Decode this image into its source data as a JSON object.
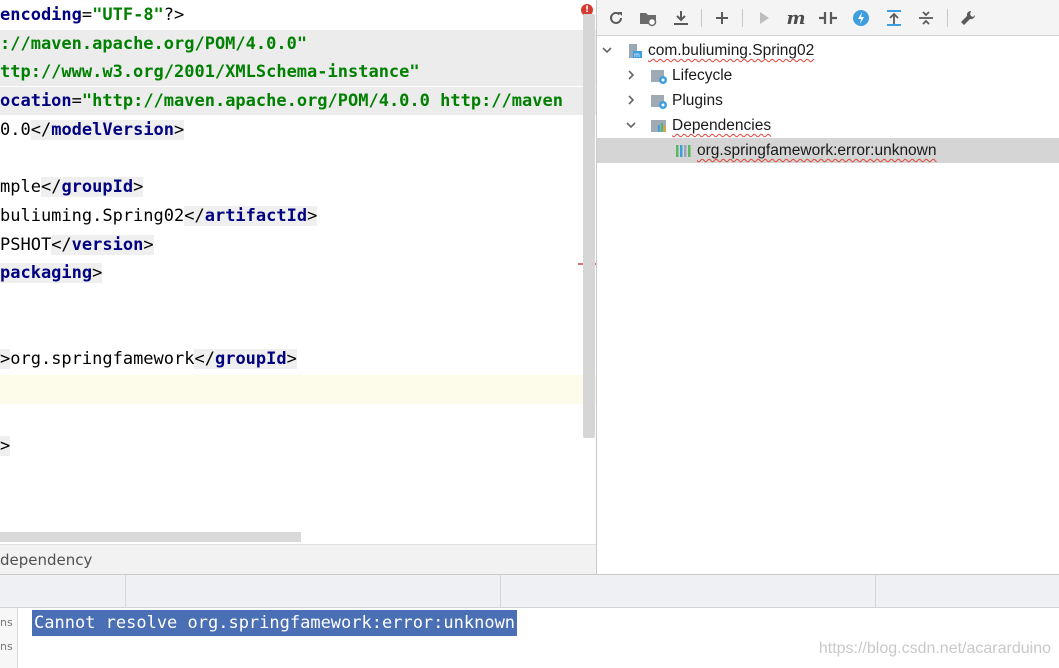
{
  "editor": {
    "lines": [
      {
        "parts": [
          [
            "tag",
            "encoding"
          ],
          [
            "pun",
            "="
          ],
          [
            "str",
            "\"UTF-8\""
          ],
          [
            "pun",
            "?>"
          ]
        ]
      },
      {
        "parts": [
          [
            "str",
            ":"
          ],
          [
            "str",
            "//maven.apache.org/POM/4.0.0\""
          ]
        ]
      },
      {
        "parts": [
          [
            "str",
            "ttp://www.w3.org/2001/XMLSchema-instance\""
          ]
        ]
      },
      {
        "parts": [
          [
            "tag",
            "ocation"
          ],
          [
            "pun",
            "="
          ],
          [
            "str",
            "\"http://maven.apache.org/POM/4.0.0 http://maven"
          ]
        ]
      },
      {
        "parts": [
          [
            "txt",
            "0.0"
          ],
          [
            "pun",
            "</"
          ],
          [
            "tag",
            "modelVersion"
          ],
          [
            "pun",
            ">"
          ]
        ]
      },
      {
        "parts": []
      },
      {
        "parts": [
          [
            "txt",
            "mple"
          ],
          [
            "pun",
            "</"
          ],
          [
            "tag",
            "groupId"
          ],
          [
            "pun",
            ">"
          ]
        ]
      },
      {
        "parts": [
          [
            "txt",
            "buliuming.Spring02"
          ],
          [
            "pun",
            "</"
          ],
          [
            "tag",
            "artifactId"
          ],
          [
            "pun",
            ">"
          ]
        ]
      },
      {
        "parts": [
          [
            "txt",
            "PSHOT"
          ],
          [
            "pun",
            "</"
          ],
          [
            "tag",
            "version"
          ],
          [
            "pun",
            ">"
          ]
        ]
      },
      {
        "parts": [
          [
            "tag",
            "packaging"
          ],
          [
            "pun",
            ">"
          ]
        ]
      },
      {
        "parts": []
      },
      {
        "parts": []
      },
      {
        "parts": [
          [
            "pun",
            ">"
          ],
          [
            "txt",
            "org.springfamework"
          ],
          [
            "pun",
            "</"
          ],
          [
            "tag",
            "groupId"
          ],
          [
            "pun",
            ">"
          ]
        ]
      },
      {
        "parts": []
      },
      {
        "parts": []
      },
      {
        "parts": [
          [
            "pun",
            ">"
          ]
        ]
      }
    ],
    "breadcrumb": "dependency",
    "error_marker": "!"
  },
  "maven": {
    "toolbar": [
      "reload-icon",
      "reimport-folder-icon",
      "download-icon",
      "add-icon",
      "run-icon",
      "execute-goal-icon",
      "toggle-offline-icon",
      "skip-tests-icon",
      "show-dependencies-icon",
      "collapse-all-icon",
      "settings-wrench-icon"
    ],
    "tree": {
      "root": "com.buliuming.Spring02",
      "children": [
        {
          "label": "Lifecycle"
        },
        {
          "label": "Plugins"
        },
        {
          "label": "Dependencies"
        }
      ],
      "dependency_item": "org.springfamework:error:unknown"
    }
  },
  "bottom": {
    "side_labels": [
      "ns",
      "ns"
    ],
    "message": "Cannot resolve org.springfamework:error:unknown",
    "watermark": "https://blog.csdn.net/acararduino"
  },
  "colors": {
    "tag": "#000080",
    "string": "#008000",
    "selection": "#4a6fb5",
    "tree_selected": "#d5d5d5"
  }
}
